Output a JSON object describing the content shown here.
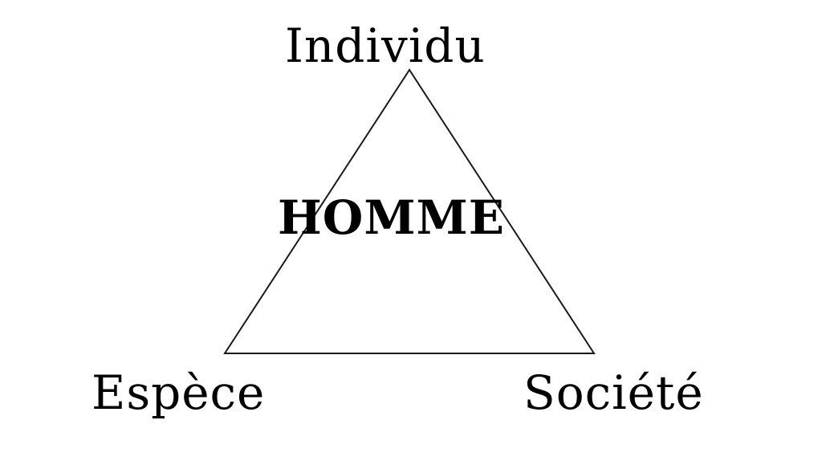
{
  "diagram": {
    "vertices": {
      "top": "Individu",
      "left": "Espèce",
      "right": "Société"
    },
    "center": "HOMME",
    "colors": {
      "line": "#1a1a1a",
      "text": "#000000",
      "background": "#ffffff"
    }
  }
}
